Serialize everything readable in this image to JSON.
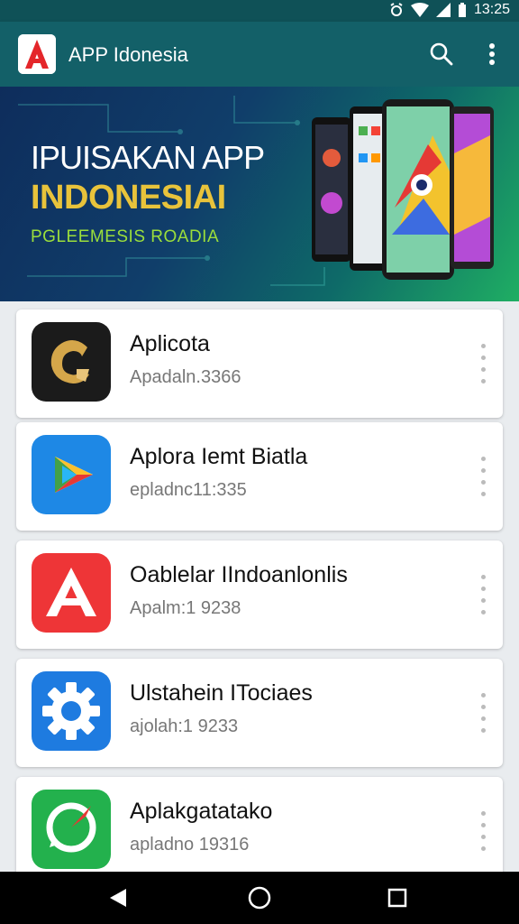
{
  "status_bar": {
    "time": "13:25",
    "icons": [
      "alarm-icon",
      "wifi-icon",
      "signal-icon",
      "battery-icon"
    ]
  },
  "app_bar": {
    "title": "APP Idonesia",
    "logo_letter": "A",
    "actions": [
      "search-icon",
      "more-vert-icon"
    ]
  },
  "banner": {
    "line1": "IPUISAKAN APP",
    "line2": "INDONESIAI",
    "line3": "PGLEEMESIS ROADIA"
  },
  "apps": [
    {
      "name": "Aplicota",
      "subtitle": "Apadaln.3366",
      "icon": "gold-c-icon"
    },
    {
      "name": "Aplora Iemt Biatla",
      "subtitle": "epladnc11:335",
      "icon": "play-triangle-icon"
    },
    {
      "name": "Oablelar IIndoanlonlis",
      "subtitle": "Apalm:1 9238",
      "icon": "letter-a-icon"
    },
    {
      "name": "Ulstahein ITociaes",
      "subtitle": "ajolah:1 9233",
      "icon": "gear-icon"
    },
    {
      "name": "Aplakgatatako",
      "subtitle": "apladno 19316",
      "icon": "chat-bubble-icon"
    }
  ],
  "colors": {
    "app_bar": "#136068",
    "status_bar": "#0f5157",
    "banner_gold": "#e8c33b",
    "banner_green": "#9bde3b"
  },
  "nav_bar": [
    "back-icon",
    "home-icon",
    "recents-icon"
  ]
}
